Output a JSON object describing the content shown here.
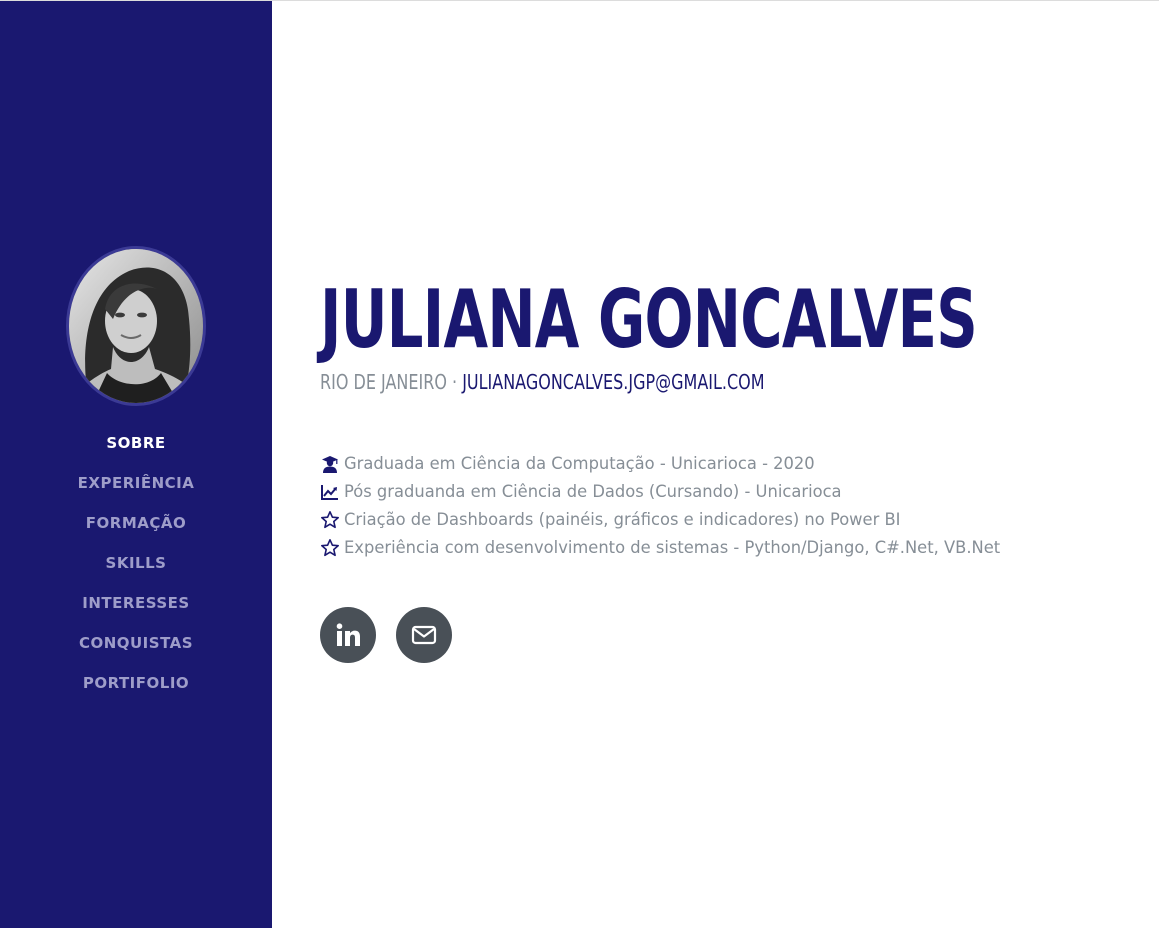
{
  "sidebar": {
    "nav": [
      {
        "label": "SOBRE",
        "active": true
      },
      {
        "label": "EXPERIÊNCIA"
      },
      {
        "label": "FORMAÇÃO"
      },
      {
        "label": "SKILLS"
      },
      {
        "label": "INTERESSES"
      },
      {
        "label": "CONQUISTAS"
      },
      {
        "label": "PORTIFOLIO"
      }
    ]
  },
  "profile": {
    "name": "JULIANA GONCALVES",
    "location": "RIO DE JANEIRO",
    "separator": " · ",
    "email": "JULIANAGONCALVES.JGP@GMAIL.COM"
  },
  "bullets": [
    {
      "icon": "graduate-icon",
      "text": "Graduada em Ciência da Computação - Unicarioca - 2020"
    },
    {
      "icon": "chart-line-icon",
      "text": "Pós graduanda em Ciência de Dados (Cursando) - Unicarioca"
    },
    {
      "icon": "star-icon",
      "text": "Criação de Dashboards (painéis, gráficos e indicadores) no Power BI"
    },
    {
      "icon": "star-icon",
      "text": "Experiência com desenvolvimento de sistemas - Python/Django, C#.Net, VB.Net"
    }
  ],
  "social": [
    {
      "icon": "linkedin-icon"
    },
    {
      "icon": "envelope-icon"
    }
  ],
  "colors": {
    "primary": "#1a1870",
    "muted": "#868e96",
    "nav_inactive": "#9e9dc9",
    "social_bg": "#495057"
  }
}
